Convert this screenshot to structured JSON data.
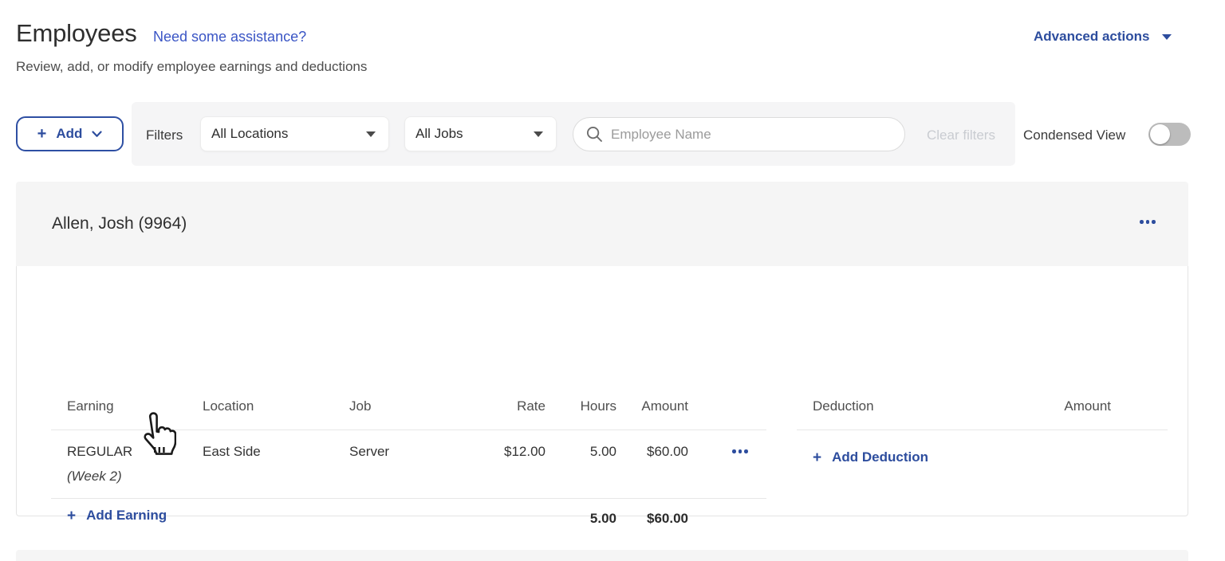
{
  "page": {
    "title": "Employees",
    "assistance_link": "Need some assistance?",
    "subtitle": "Review, add, or modify employee earnings and deductions",
    "advanced_actions_label": "Advanced actions"
  },
  "filter_bar": {
    "add_button_label": "Add",
    "filters_label": "Filters",
    "locations_dropdown_value": "All Locations",
    "jobs_dropdown_value": "All Jobs",
    "search_placeholder": "Employee Name",
    "search_value": "",
    "clear_filters_label": "Clear filters",
    "clear_filters_enabled": false,
    "condensed_view_label": "Condensed View",
    "condensed_view_state": "off"
  },
  "employee_card": {
    "name": "Allen, Josh (9964)",
    "earnings_table": {
      "headers": {
        "earning": "Earning",
        "location": "Location",
        "job": "Job",
        "rate": "Rate",
        "hours": "Hours",
        "amount": "Amount"
      },
      "rows": [
        {
          "earning": "REGULAR",
          "earning_note": "(Week 2)",
          "location": "East Side",
          "job": "Server",
          "rate": "$12.00",
          "hours": "5.00",
          "amount": "$60.00"
        }
      ],
      "add_earning_label": "Add Earning",
      "totals": {
        "hours": "5.00",
        "amount": "$60.00"
      }
    },
    "deductions_table": {
      "headers": {
        "deduction": "Deduction",
        "amount": "Amount"
      },
      "add_deduction_label": "Add Deduction"
    }
  },
  "icons": {
    "plus": "+",
    "search": "magnifier",
    "chevron_down": "chevron-down",
    "caret_down": "caret-down",
    "kebab": "ellipsis-menu",
    "cursor": "hand-pointer"
  },
  "colors": {
    "accent_blue": "#2d4d9e",
    "link_blue": "#3a55c5",
    "filter_bar_bg": "#f5f5f6",
    "card_header_bg": "#f5f5f5",
    "border": "#e4e4e4",
    "disabled_text": "#c9ccd1",
    "toggle_track": "#bcbcbc"
  }
}
